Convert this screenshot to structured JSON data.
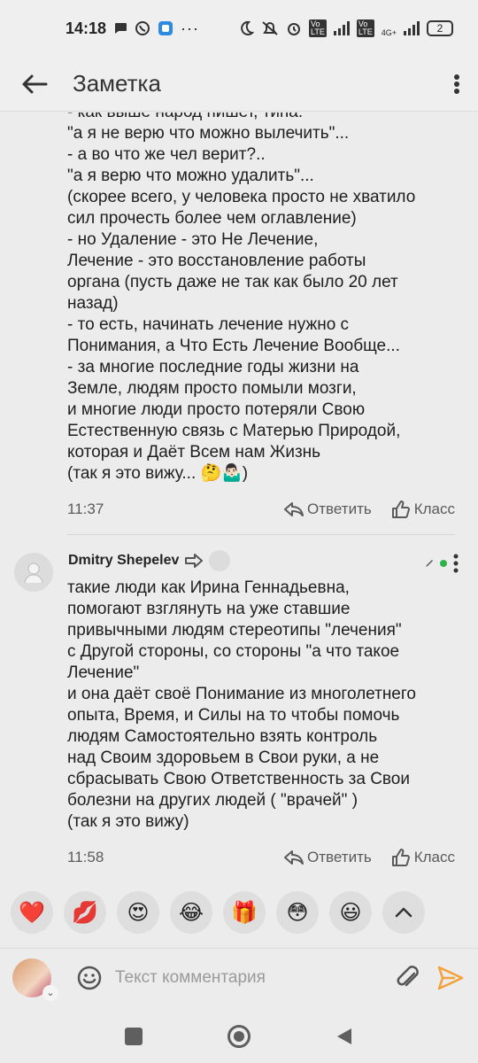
{
  "status_bar": {
    "time": "14:18",
    "battery": "2",
    "network_label": "4G+"
  },
  "app_bar": {
    "title": "Заметка"
  },
  "comment1": {
    "text_visible": "- как выше народ пишет, типа:\n\"а я не верю что можно вылечить\"...\n- а во что же чел верит?..\n\"а я верю что можно удалить\"...\n(скорее всего, у человека просто не хватило\nсил прочесть более чем оглавление)\n- но Удаление - это Не Лечение,\nЛечение - это восстановление работы\nоргана (пусть даже не так как было 20 лет\nназад)\n- то есть, начинать лечение нужно с\nПонимания, а Что Есть Лечение Вообще...\n- за многие последние годы жизни на\nЗемле, людям просто помыли мозги,\nи многие люди просто потеряли Свою\nЕстественную связь с Матерью Природой,\nкоторая и Даёт Всем нам Жизнь\n(так я это вижу... 🤔🤷🏻‍♂️)",
    "time": "11:37",
    "reply_label": "Ответить",
    "like_label": "Класс"
  },
  "comment2": {
    "author": "Dmitry Shepelev",
    "text": "такие люди как Ирина Геннадьевна,\nпомогают взглянуть на уже ставшие\nпривычными людям стереотипы \"лечения\"\nс Другой стороны, со стороны \"а что такое\nЛечение\"\nи она даёт своё Понимание из многолетнего\nопыта, Время, и Силы на то чтобы помочь\nлюдям Самостоятельно взять контроль\nнад Своим здоровьем в Свои руки, а не\nсбрасывать Свою Ответственность за Свои\nболезни на других людей ( \"врачей\" )\n(так я это вижу)",
    "time": "11:58",
    "reply_label": "Ответить",
    "like_label": "Класс"
  },
  "reactions": [
    "❤️",
    "💋",
    "😍",
    "😂",
    "🎁",
    "😳",
    "😃"
  ],
  "input": {
    "placeholder": "Текст комментария"
  },
  "colors": {
    "background": "#ececec",
    "text": "#1e1e1e",
    "muted": "#5a5a5a",
    "send_accent": "#f3a23a",
    "online_dot": "#2cb34a"
  }
}
